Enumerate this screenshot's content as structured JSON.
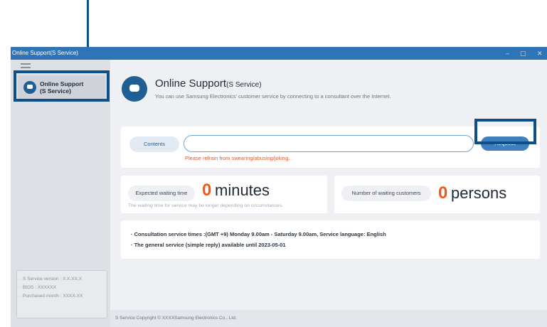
{
  "window": {
    "title": "Online Support(S Service)",
    "controls": {
      "minimize": "–",
      "maximize": "▢",
      "close": "✕"
    }
  },
  "sidebar": {
    "items": [
      {
        "label_line1": "Online Support",
        "label_line2": "(S Service)",
        "icon": "chat-icon"
      }
    ],
    "info": {
      "version": "· S Service version : X.X.XX.X",
      "bios": "· BIOS : XXXXXX",
      "purchased": "· Purchased month : XXXX-XX"
    }
  },
  "header": {
    "title": "Online Support",
    "title_sub": "(S Service)",
    "description": "You can use Samsung Electronics' customer service by connecting to a consultant over the Internet."
  },
  "request": {
    "contents_label": "Contents",
    "contents_value": "",
    "warning": "Please refrain from swearing/abusing/joking.",
    "button_label": "Request"
  },
  "waiting": {
    "label": "Expected waiting time",
    "value": "0",
    "unit": "minutes",
    "note": "The waiting time for service may be longer depending on circumstances."
  },
  "customers": {
    "label": "Number of waiting customers",
    "value": "0",
    "unit": "persons"
  },
  "notes": {
    "line1": "· Consultation service times :(GMT +9) Monday 9.00am - Saturday 9.00am, Service language: English",
    "line2": "· The general service (simple reply) available until 2023-05-01"
  },
  "footer": {
    "copyright": "S Service Copyright © XXXXSamsung Electronics Co., Ltd."
  },
  "colors": {
    "titlebar": "#2f74b6",
    "accent": "#1f5f95",
    "highlight": "#0c4f8a",
    "warning": "#e0572f",
    "number": "#ef5a1e"
  }
}
